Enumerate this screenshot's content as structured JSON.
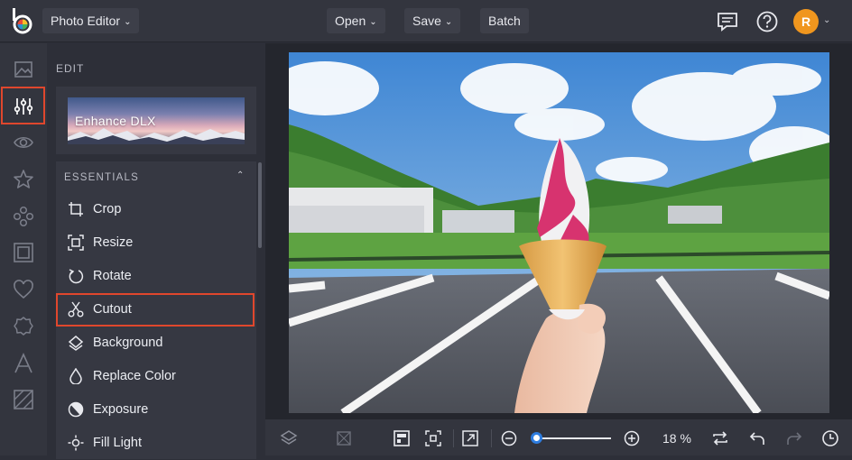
{
  "topbar": {
    "app_menu": "Photo Editor",
    "open": "Open",
    "save": "Save",
    "batch": "Batch",
    "avatar_initial": "R",
    "icons": [
      "chat-icon",
      "help-icon"
    ]
  },
  "leftbar": {
    "items": [
      "image-icon",
      "adjust-sliders-icon",
      "eye-icon",
      "star-icon",
      "graphics-icon",
      "frame-icon",
      "heart-icon",
      "badge-icon",
      "text-icon",
      "texture-icon"
    ],
    "active": "adjust-sliders-icon"
  },
  "panel": {
    "section_title": "EDIT",
    "enhance_label": "Enhance DLX",
    "essentials_title": "ESSENTIALS",
    "tools": [
      "Crop",
      "Resize",
      "Rotate",
      "Cutout",
      "Background",
      "Replace Color",
      "Exposure",
      "Fill Light"
    ],
    "selected_tool": "Cutout"
  },
  "bottombar": {
    "zoom_label": "18 %",
    "zoom_percent": 18
  },
  "colors": {
    "highlight": "#e0472d",
    "accent": "#2e7de0",
    "avatar": "#f0961e"
  }
}
